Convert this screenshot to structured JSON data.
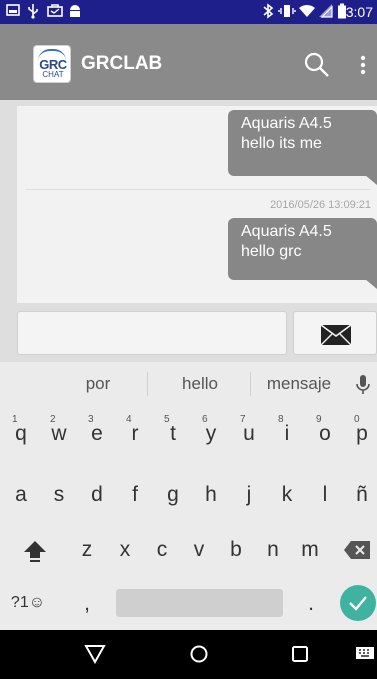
{
  "status_bar": {
    "time": "13:07",
    "left_icons": [
      "screenshot-icon",
      "usb-icon",
      "briefcase-icon",
      "android-icon"
    ],
    "right_icons": [
      "bluetooth-icon",
      "vibrate-icon",
      "wifi-icon",
      "signal-icon",
      "battery-icon"
    ]
  },
  "app_bar": {
    "logo_text_top": "GRC",
    "logo_text_bottom": "CHAT",
    "title": "GRCLAB",
    "actions": [
      "search-icon",
      "more-vert-icon"
    ]
  },
  "messages": [
    {
      "sender": "Aquaris A4.5",
      "text": "hello its me",
      "timestamp": ""
    },
    {
      "sender": "Aquaris A4.5",
      "text": "hello grc",
      "timestamp": "2016/05/26 13:09:21"
    }
  ],
  "composer": {
    "value": "",
    "send_icon": "envelope-icon"
  },
  "keyboard": {
    "suggestions": [
      "por",
      "hello",
      "mensaje"
    ],
    "mic_icon": "mic-icon",
    "row1": [
      "q",
      "w",
      "e",
      "r",
      "t",
      "y",
      "u",
      "i",
      "o",
      "p"
    ],
    "row1_numbers": [
      "1",
      "2",
      "3",
      "4",
      "5",
      "6",
      "7",
      "8",
      "9",
      "0"
    ],
    "row2": [
      "a",
      "s",
      "d",
      "f",
      "g",
      "h",
      "j",
      "k",
      "l",
      "ñ"
    ],
    "row3": [
      "z",
      "x",
      "c",
      "v",
      "b",
      "n",
      "m"
    ],
    "symbols_key": "?1☺",
    "comma_key": ",",
    "period_key": ".",
    "shift_icon": "shift-icon",
    "backspace_icon": "backspace-icon",
    "enter_icon": "check-icon"
  },
  "nav_bar": [
    "back-icon",
    "home-icon",
    "recents-icon",
    "keyboard-icon"
  ],
  "colors": {
    "status_bar": "#1f1f8c",
    "app_bar": "#8a8a8a",
    "bubble": "#878787",
    "enter_key": "#3fb3a0"
  }
}
